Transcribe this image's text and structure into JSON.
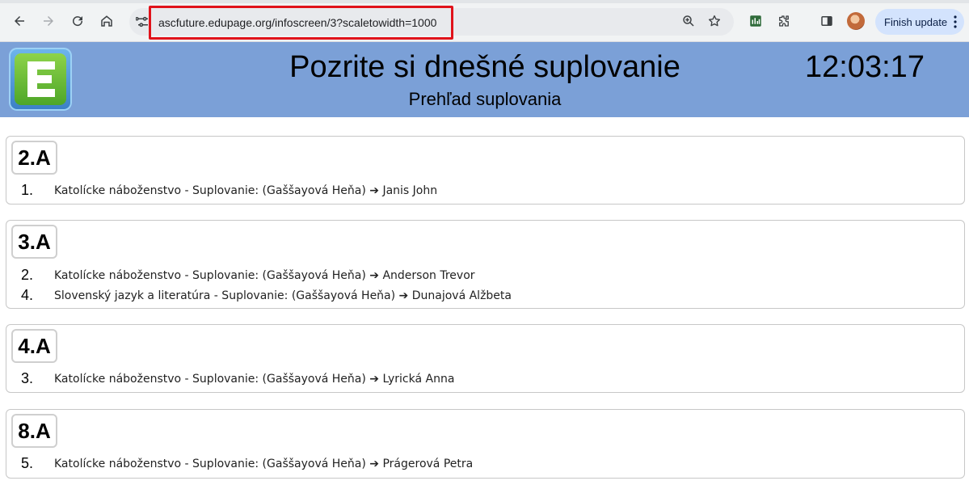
{
  "browser": {
    "url": "ascfuture.edupage.org/infoscreen/3?scaletowidth=1000",
    "update_button_label": "Finish update"
  },
  "header": {
    "title": "Pozrite si dnešné suplovanie",
    "subtitle": "Prehľad suplovania",
    "clock": "12:03:17"
  },
  "colors": {
    "header_bg": "#7ba0d7",
    "url_highlight": "#e0131b",
    "logo_green": "#4ea628"
  },
  "classes": [
    {
      "name": "2.A",
      "rows": [
        {
          "lesson": "1.",
          "text": "Katolícke náboženstvo - Suplovanie: (Gaššayová Heňa) ➔ Janis John"
        }
      ]
    },
    {
      "name": "3.A",
      "rows": [
        {
          "lesson": "2.",
          "text": "Katolícke náboženstvo - Suplovanie: (Gaššayová Heňa) ➔ Anderson Trevor"
        },
        {
          "lesson": "4.",
          "text": "Slovenský jazyk a literatúra - Suplovanie: (Gaššayová Heňa) ➔ Dunajová Alžbeta"
        }
      ]
    },
    {
      "name": "4.A",
      "rows": [
        {
          "lesson": "3.",
          "text": "Katolícke náboženstvo - Suplovanie: (Gaššayová Heňa) ➔ Lyrická Anna"
        }
      ]
    },
    {
      "name": "8.A",
      "rows": [
        {
          "lesson": "5.",
          "text": "Katolícke náboženstvo - Suplovanie: (Gaššayová Heňa) ➔ Prágerová Petra"
        }
      ]
    }
  ]
}
